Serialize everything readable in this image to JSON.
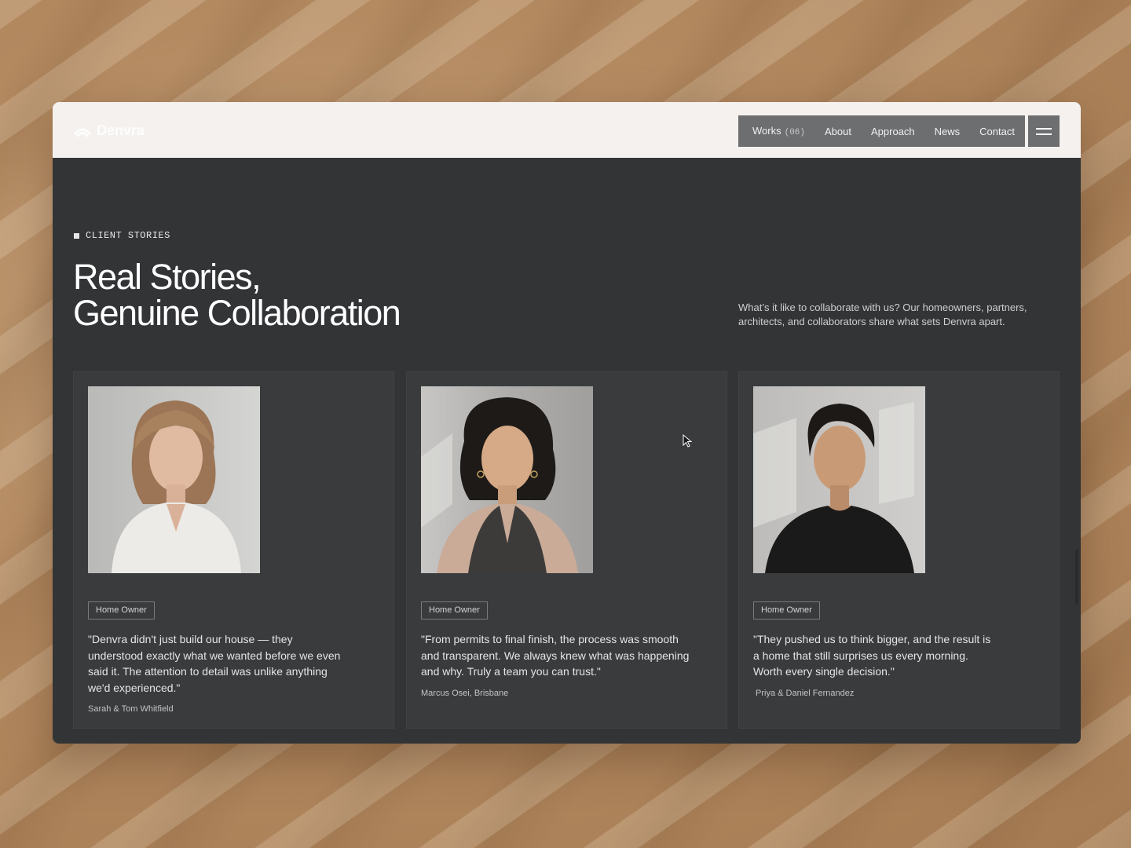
{
  "header": {
    "logo_text": "Denvra",
    "nav": [
      {
        "label": "Works",
        "count": "(06)"
      },
      {
        "label": "About"
      },
      {
        "label": "Approach"
      },
      {
        "label": "News"
      },
      {
        "label": "Contact"
      }
    ]
  },
  "hero": {
    "eyebrow": "CLIENT STORIES",
    "title_line1": "Real Stories,",
    "title_line2": "Genuine Collaboration",
    "intro": "What’s it like to collaborate with us? Our homeowners, partners, architects, and collaborators share what sets Denvra apart."
  },
  "testimonials": [
    {
      "tag": "Home Owner",
      "quote": "\"Denvra didn't just build our house — they understood exactly what we wanted before we even said it. The attention to detail was unlike anything we'd experienced.\"",
      "author": "Sarah & Tom Whitfield"
    },
    {
      "tag": "Home Owner",
      "quote": "\"From permits to final finish, the process was smooth and transparent. We always knew what was happening and why. Truly a team you can trust.\"",
      "author": "Marcus Osei, Brisbane"
    },
    {
      "tag": "Home Owner",
      "quote": "\"They pushed us to think bigger, and the result is a home that still surprises us every morning. Worth every single decision.\"",
      "author": "Priya & Daniel Fernandez"
    }
  ],
  "colors": {
    "background": "#b48a61",
    "panel": "#333436",
    "card": "#3a3b3d",
    "topbar": "#f4f1ee",
    "nav": "#6d6e70"
  }
}
